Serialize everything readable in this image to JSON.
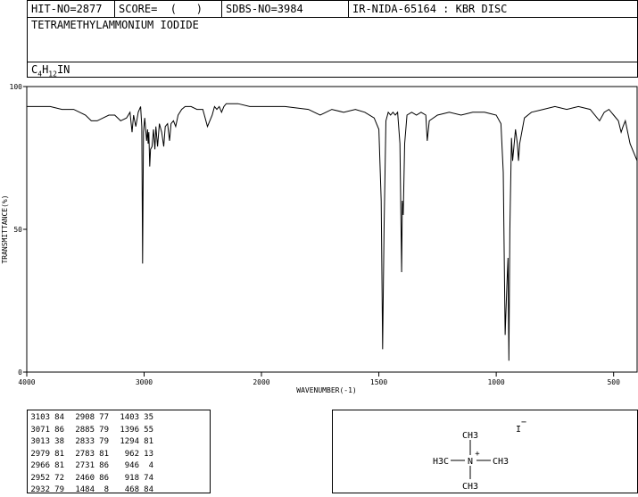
{
  "header": {
    "hit_no": "HIT-NO=2877",
    "score": "SCORE=  (   )",
    "sdbs_no": "SDBS-NO=3984",
    "ir_info": "IR-NIDA-65164 : KBR DISC"
  },
  "compound": {
    "name": "TETRAMETHYLAMMONIUM IODIDE",
    "formula": "C4H12IN"
  },
  "chart_data": {
    "type": "line",
    "xlabel": "WAVENUMBER(-1)",
    "ylabel": "TRANSMITTANCE(%)",
    "xlim": [
      4000,
      400
    ],
    "ylim": [
      0,
      100
    ],
    "x_ticks": [
      "4000",
      "3000",
      "2000",
      "1500",
      "1000",
      "500"
    ],
    "y_ticks": [
      "100",
      "50",
      "0"
    ],
    "series": [
      {
        "x": [
          4000,
          3900,
          3800,
          3700,
          3600,
          3500,
          3450,
          3400,
          3350,
          3300,
          3250,
          3200,
          3150,
          3120,
          3103,
          3090,
          3071,
          3050,
          3030,
          3020,
          3013,
          3005,
          2995,
          2979,
          2970,
          2966,
          2960,
          2952,
          2945,
          2932,
          2920,
          2908,
          2900,
          2885,
          2870,
          2850,
          2833,
          2820,
          2800,
          2783,
          2770,
          2750,
          2731,
          2710,
          2680,
          2650,
          2600,
          2550,
          2500,
          2460,
          2420,
          2400,
          2380,
          2360,
          2340,
          2320,
          2300,
          2200,
          2100,
          2000,
          1900,
          1800,
          1750,
          1700,
          1650,
          1600,
          1560,
          1520,
          1500,
          1490,
          1484,
          1478,
          1470,
          1460,
          1450,
          1440,
          1430,
          1420,
          1410,
          1403,
          1400,
          1396,
          1390,
          1380,
          1360,
          1340,
          1320,
          1300,
          1294,
          1285,
          1250,
          1200,
          1150,
          1100,
          1050,
          1000,
          980,
          970,
          962,
          955,
          950,
          946,
          942,
          935,
          930,
          918,
          910,
          905,
          900,
          880,
          850,
          800,
          750,
          700,
          650,
          600,
          560,
          540,
          520,
          500,
          480,
          468,
          460,
          450,
          430,
          410,
          400
        ],
        "y": [
          93,
          93,
          93,
          92,
          92,
          90,
          88,
          88,
          89,
          90,
          90,
          88,
          89,
          91,
          84,
          90,
          86,
          91,
          93,
          86,
          38,
          84,
          89,
          81,
          85,
          80,
          84,
          72,
          78,
          79,
          85,
          78,
          86,
          79,
          87,
          84,
          79,
          86,
          87,
          81,
          87,
          88,
          86,
          90,
          92,
          93,
          93,
          92,
          92,
          86,
          90,
          93,
          92,
          93,
          91,
          93,
          94,
          94,
          93,
          93,
          93,
          92,
          90,
          92,
          91,
          92,
          91,
          89,
          85,
          60,
          8,
          50,
          88,
          91,
          90,
          91,
          90,
          91,
          80,
          35,
          60,
          55,
          80,
          90,
          91,
          90,
          91,
          90,
          81,
          88,
          90,
          91,
          90,
          91,
          91,
          90,
          87,
          70,
          13,
          30,
          40,
          4,
          50,
          82,
          74,
          85,
          80,
          74,
          80,
          89,
          91,
          92,
          93,
          92,
          93,
          92,
          88,
          91,
          92,
          90,
          88,
          84,
          86,
          88,
          80,
          76,
          74
        ]
      }
    ],
    "peak_table": [
      [
        "3103",
        "84",
        "2908",
        "77",
        "1403",
        "35"
      ],
      [
        "3071",
        "86",
        "2885",
        "79",
        "1396",
        "55"
      ],
      [
        "3013",
        "38",
        "2833",
        "79",
        "1294",
        "81"
      ],
      [
        "2979",
        "81",
        "2783",
        "81",
        "962",
        "13"
      ],
      [
        "2966",
        "81",
        "2731",
        "86",
        "946",
        "4"
      ],
      [
        "2952",
        "72",
        "2460",
        "86",
        "918",
        "74"
      ],
      [
        "2932",
        "79",
        "1484",
        "8",
        "468",
        "84"
      ]
    ]
  },
  "structure": {
    "ion": "I",
    "charge_minus": "−",
    "charge_plus": "+",
    "center": "N",
    "top": "CH3",
    "bottom": "CH3",
    "left": "H3C",
    "right": "CH3"
  }
}
